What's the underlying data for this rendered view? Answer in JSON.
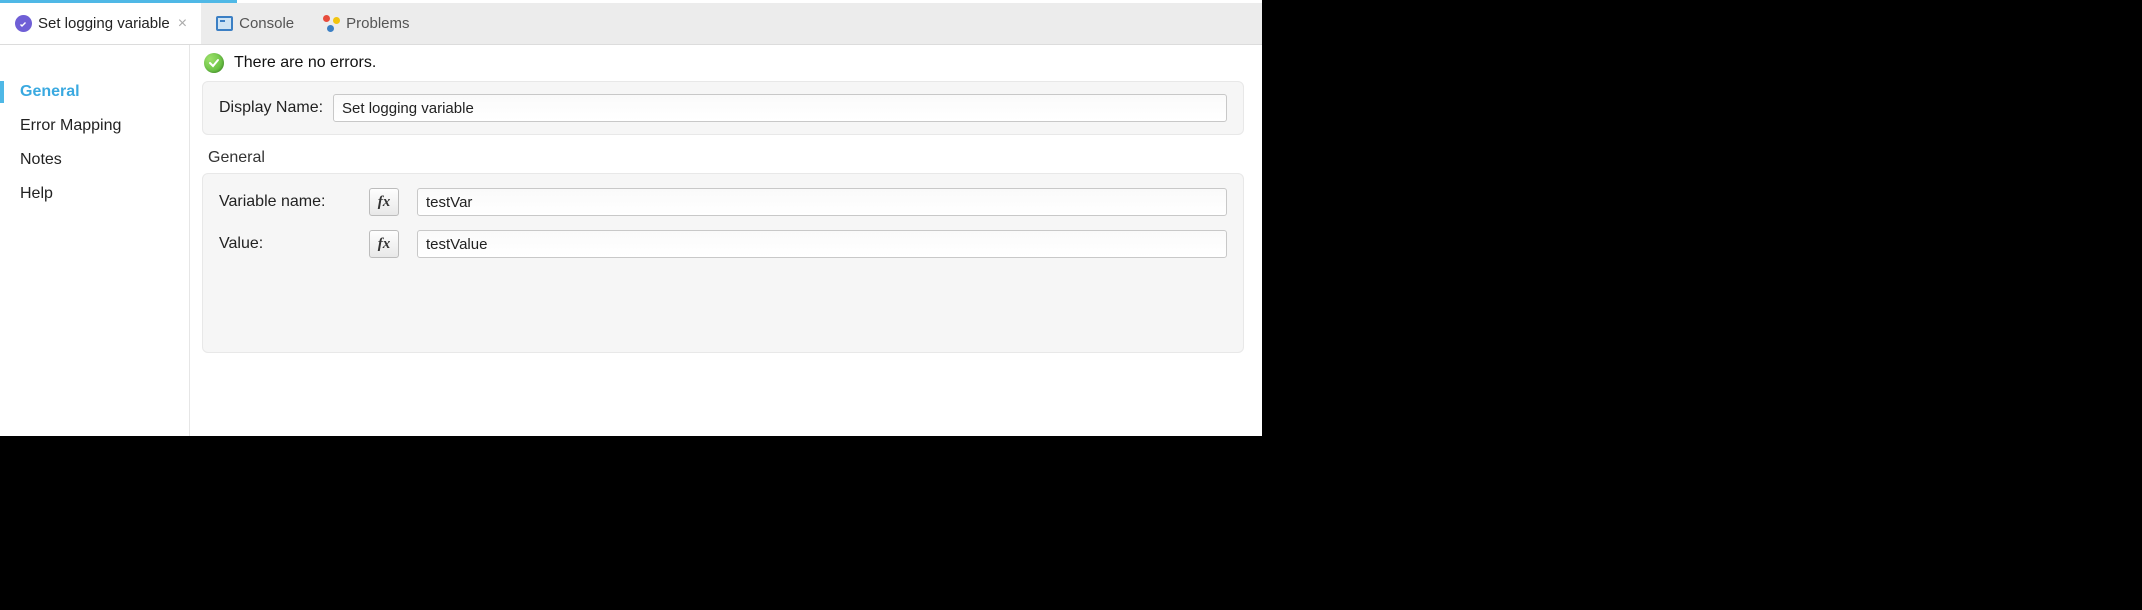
{
  "tabs": {
    "editor": {
      "label": "Set logging variable"
    },
    "console": {
      "label": "Console"
    },
    "problems": {
      "label": "Problems"
    }
  },
  "sidebar": {
    "items": [
      {
        "label": "General"
      },
      {
        "label": "Error Mapping"
      },
      {
        "label": "Notes"
      },
      {
        "label": "Help"
      }
    ]
  },
  "status": {
    "text": "There are no errors."
  },
  "form": {
    "displayNameLabel": "Display Name:",
    "displayNameValue": "Set logging variable",
    "sectionTitle": "General",
    "varNameLabel": "Variable name:",
    "varNameValue": "testVar",
    "valueLabel": "Value:",
    "valueValue": "testValue",
    "fxGlyph": "fx"
  }
}
